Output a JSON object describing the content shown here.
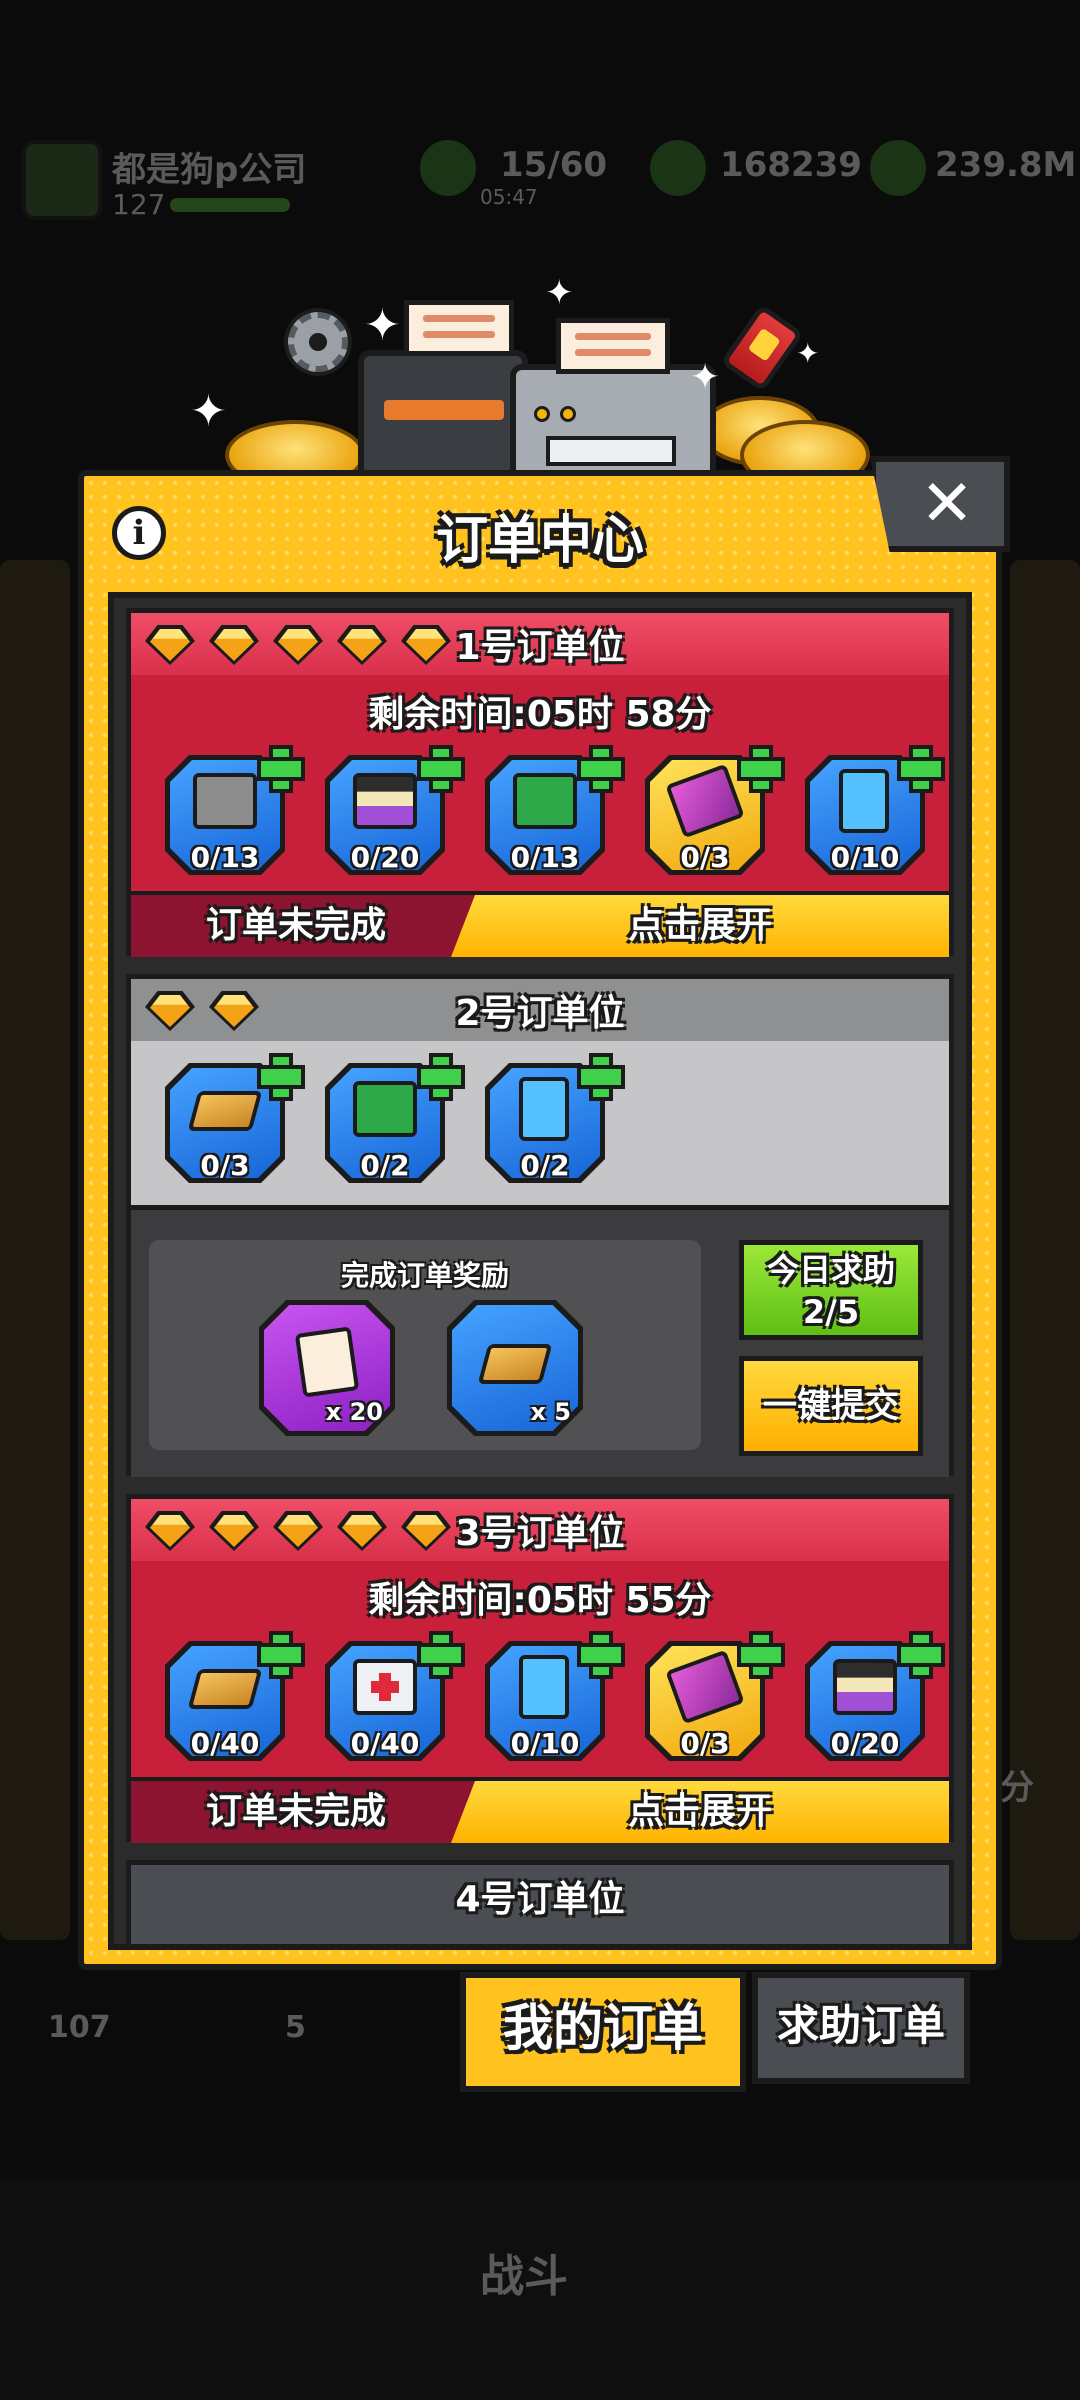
{
  "background": {
    "company_name": "都是狗p公司",
    "level": "127",
    "stat_1": "15/60",
    "stat_1_sub": "05:47",
    "stat_2": "168239",
    "stat_3": "239.8M",
    "bottom_left_count": "107",
    "bottom_mid_count": "5",
    "battle_label": "战斗",
    "right_fragment": "分"
  },
  "panel": {
    "title": "订单中心",
    "info_icon": "i",
    "close_icon": "✕"
  },
  "orders": [
    {
      "title": "1号订单位",
      "gems": 5,
      "timer": "剩余时间:05时 58分",
      "items": [
        {
          "icon": "stone-block-icon",
          "count": "0/13",
          "bg": "blue"
        },
        {
          "icon": "purple-chest-icon",
          "count": "0/20",
          "bg": "blue"
        },
        {
          "icon": "green-toolbox-icon",
          "count": "0/13",
          "bg": "blue"
        },
        {
          "icon": "pink-battery-icon",
          "count": "0/3",
          "bg": "gold"
        },
        {
          "icon": "blue-card-icon",
          "count": "0/10",
          "bg": "blue"
        }
      ],
      "status": "订单未完成",
      "expand": "点击展开"
    },
    {
      "title": "2号订单位",
      "gems": 2,
      "items": [
        {
          "icon": "wood-plank-icon",
          "count": "0/3",
          "bg": "blue"
        },
        {
          "icon": "green-toolbox-icon",
          "count": "0/2",
          "bg": "blue"
        },
        {
          "icon": "blue-card-icon",
          "count": "0/2",
          "bg": "blue"
        }
      ],
      "reward_title": "完成订单奖励",
      "rewards": [
        {
          "icon": "paper-stack-icon",
          "qty": "x 20",
          "bg": "purple"
        },
        {
          "icon": "wood-plank-icon",
          "qty": "x 5",
          "bg": "blue"
        }
      ],
      "help_btn": [
        "今日求助",
        "2/5"
      ],
      "submit_btn": "一键提交"
    },
    {
      "title": "3号订单位",
      "gems": 5,
      "timer": "剩余时间:05时 55分",
      "items": [
        {
          "icon": "wood-plank-icon",
          "count": "0/40",
          "bg": "blue"
        },
        {
          "icon": "first-aid-kit-icon",
          "count": "0/40",
          "bg": "blue"
        },
        {
          "icon": "blue-card-icon",
          "count": "0/10",
          "bg": "blue"
        },
        {
          "icon": "pink-battery-icon",
          "count": "0/3",
          "bg": "gold"
        },
        {
          "icon": "purple-chest-icon",
          "count": "0/20",
          "bg": "blue"
        }
      ],
      "status": "订单未完成",
      "expand": "点击展开"
    },
    {
      "title": "4号订单位"
    }
  ],
  "tabs": {
    "mine": "我的订单",
    "help": "求助订单"
  },
  "colors": {
    "panel_yellow": "#ffc21f",
    "order_red": "#c8203a",
    "item_blue": "#1765d8",
    "plus_green": "#3fd14a"
  }
}
